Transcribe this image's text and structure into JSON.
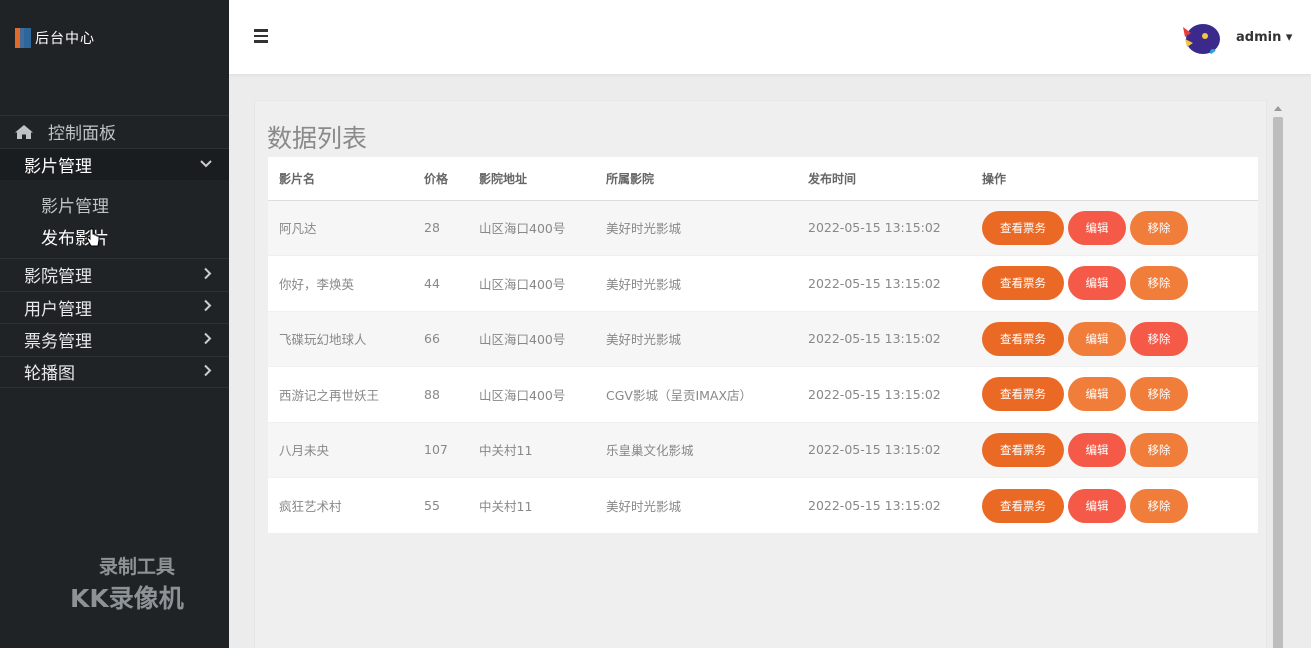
{
  "brand": {
    "title": "后台中心"
  },
  "sidebar": {
    "items": [
      {
        "label": "控制面板"
      },
      {
        "label": "影片管理",
        "submenu": [
          {
            "label": "影片管理"
          },
          {
            "label": "发布影片"
          }
        ]
      },
      {
        "label": "影院管理"
      },
      {
        "label": "用户管理"
      },
      {
        "label": "票务管理"
      },
      {
        "label": "轮播图"
      }
    ]
  },
  "watermark": {
    "line1": "录制工具",
    "line2": "KK录像机"
  },
  "header": {
    "user": "admin",
    "user_caret": "▾"
  },
  "panel": {
    "title": "数据列表"
  },
  "table": {
    "headers": [
      "影片名",
      "价格",
      "影院地址",
      "所属影院",
      "发布时间",
      "操作"
    ],
    "rows": [
      {
        "name": "阿凡达",
        "price": "28",
        "address": "山区海口400号",
        "cinema": "美好时光影城",
        "time": "2022-05-15 13:15:02",
        "edit_color": "#f45a47",
        "del_color": "#f07d3a"
      },
      {
        "name": "你好，李焕英",
        "price": "44",
        "address": "山区海口400号",
        "cinema": "美好时光影城",
        "time": "2022-05-15 13:15:02",
        "edit_color": "#f45a47",
        "del_color": "#f07d3a"
      },
      {
        "name": "飞碟玩幻地球人",
        "price": "66",
        "address": "山区海口400号",
        "cinema": "美好时光影城",
        "time": "2022-05-15 13:15:02",
        "edit_color": "#f07d3a",
        "del_color": "#f45a47"
      },
      {
        "name": "西游记之再世妖王",
        "price": "88",
        "address": "山区海口400号",
        "cinema": "CGV影城（呈贡IMAX店）",
        "time": "2022-05-15 13:15:02",
        "edit_color": "#f07d3a",
        "del_color": "#f07d3a"
      },
      {
        "name": "八月未央",
        "price": "107",
        "address": "中关村11",
        "cinema": "乐皇巢文化影城",
        "time": "2022-05-15 13:15:02",
        "edit_color": "#f45a47",
        "del_color": "#f07d3a"
      },
      {
        "name": "疯狂艺术村",
        "price": "55",
        "address": "中关村11",
        "cinema": "美好时光影城",
        "time": "2022-05-15 13:15:02",
        "edit_color": "#f45a47",
        "del_color": "#f07d3a"
      }
    ],
    "buttons": {
      "view": "查看票务",
      "edit": "编辑",
      "delete": "移除"
    }
  },
  "colors": {
    "sidebar_bg": "#1f2326",
    "accent": "#ea6a25"
  },
  "icons": {
    "menu": "hamburger-icon",
    "home": "home-icon",
    "chevron_down": "chevron-down-icon",
    "chevron_right": "chevron-right-icon"
  }
}
